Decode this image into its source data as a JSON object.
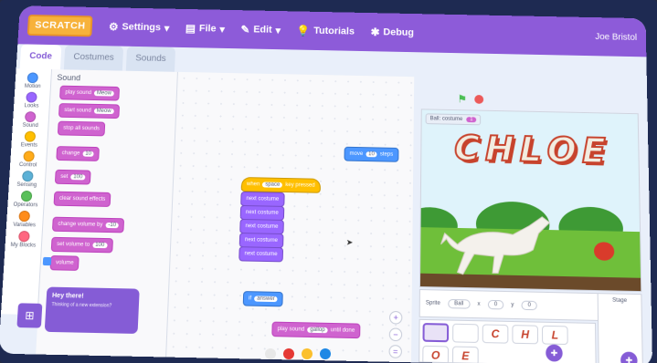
{
  "menubar": {
    "logo": "SCRATCH",
    "settings": "Settings",
    "file": "File",
    "edit": "Edit",
    "tutorials": "Tutorials",
    "debug": "Debug",
    "user": "Joe Bristol"
  },
  "tabs": {
    "code": "Code",
    "costumes": "Costumes",
    "sounds": "Sounds"
  },
  "categories": [
    {
      "label": "Motion",
      "color": "#4c97ff"
    },
    {
      "label": "Looks",
      "color": "#9966ff"
    },
    {
      "label": "Sound",
      "color": "#cf63cf"
    },
    {
      "label": "Events",
      "color": "#ffbf00"
    },
    {
      "label": "Control",
      "color": "#ffab19"
    },
    {
      "label": "Sensing",
      "color": "#5cb1d6"
    },
    {
      "label": "Operators",
      "color": "#59c059"
    },
    {
      "label": "Variables",
      "color": "#ff8c1a"
    },
    {
      "label": "My Blocks",
      "color": "#ff6680"
    }
  ],
  "palette": {
    "title": "Sound",
    "blocks": [
      {
        "text": "play sound",
        "input": "Meow"
      },
      {
        "text": "start sound",
        "input": "Meow"
      },
      {
        "text": "stop all sounds",
        "input": ""
      },
      {
        "text": "change",
        "input": "10"
      },
      {
        "text": "set",
        "input": "100"
      },
      {
        "text": "clear sound effects",
        "input": ""
      },
      {
        "text": "change volume by",
        "input": "-10"
      },
      {
        "text": "set volume to",
        "input": "100"
      },
      {
        "text": "volume",
        "input": ""
      }
    ]
  },
  "hint": {
    "title": "Hey there!",
    "text": "Thinking of a new extension?"
  },
  "workspace": {
    "move_block": {
      "text": "move",
      "input": "10",
      "suffix": "steps"
    },
    "hat_block": {
      "text": "when",
      "input": "space",
      "suffix": "key pressed"
    },
    "stack": [
      "next costume",
      "next costume",
      "next costume",
      "next costume",
      "next costume"
    ],
    "repeat_block": {
      "text": "if",
      "input": "answer",
      "suffix": ""
    },
    "play_block": {
      "text": "play sound",
      "input": "gallop",
      "suffix": "until done"
    }
  },
  "stage": {
    "title_letters": [
      "C",
      "H",
      "L",
      "O",
      "E"
    ],
    "monitor_label": "Ball: costume",
    "monitor_value": "1"
  },
  "sprite_info": {
    "sprite_label": "Sprite",
    "sprite_name": "Ball",
    "x_label": "x",
    "y_label": "y",
    "x_value": "0",
    "y_value": "0",
    "stage_label": "Stage"
  },
  "sprites": [
    "",
    "",
    "C",
    "H",
    "L",
    "O",
    "E"
  ]
}
